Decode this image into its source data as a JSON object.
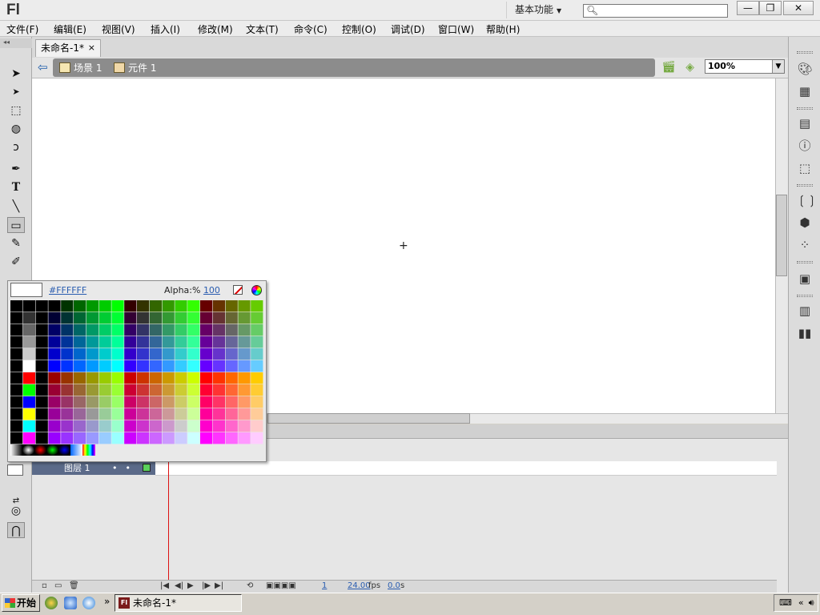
{
  "app": {
    "logo": "Fl",
    "workspace": "基本功能",
    "search_placeholder": ""
  },
  "window_controls": {
    "minimize": "—",
    "restore": "❐",
    "close": "✕"
  },
  "menu": [
    "文件(F)",
    "编辑(E)",
    "视图(V)",
    "插入(I)",
    "修改(M)",
    "文本(T)",
    "命令(C)",
    "控制(O)",
    "调试(D)",
    "窗口(W)",
    "帮助(H)"
  ],
  "document": {
    "tab_title": "未命名-1*",
    "tab_close": "×"
  },
  "breadcrumb": {
    "scene": "场景 1",
    "symbol": "元件 1"
  },
  "zoom": {
    "value": "100%"
  },
  "color_palette": {
    "hex": "#FFFFFF",
    "alpha_label": "Alpha:%",
    "alpha_value": "100",
    "preview_color": "#FFFFFF"
  },
  "timeline": {
    "layer_name": "图层 1",
    "current_frame": "1",
    "fps": "24.00",
    "fps_unit": "fps",
    "elapsed": "0.0",
    "elapsed_unit": "s"
  },
  "taskbar": {
    "start": "开始",
    "task_label": "未命名-1*",
    "task_icon": "Fl",
    "quicklaunch_more": "»",
    "tray_more": "«"
  },
  "icons": [
    "selection-tool-icon",
    "subselection-tool-icon",
    "free-transform-icon",
    "3d-rotation-icon",
    "lasso-icon",
    "pen-icon",
    "text-tool-icon",
    "line-tool-icon",
    "rectangle-tool-icon",
    "pencil-icon",
    "brush-icon",
    "color-icon",
    "swatches-icon",
    "align-icon",
    "info-icon",
    "transform-icon",
    "actions-icon",
    "components-icon",
    "motion-presets-icon",
    "project-icon",
    "library-icon"
  ]
}
